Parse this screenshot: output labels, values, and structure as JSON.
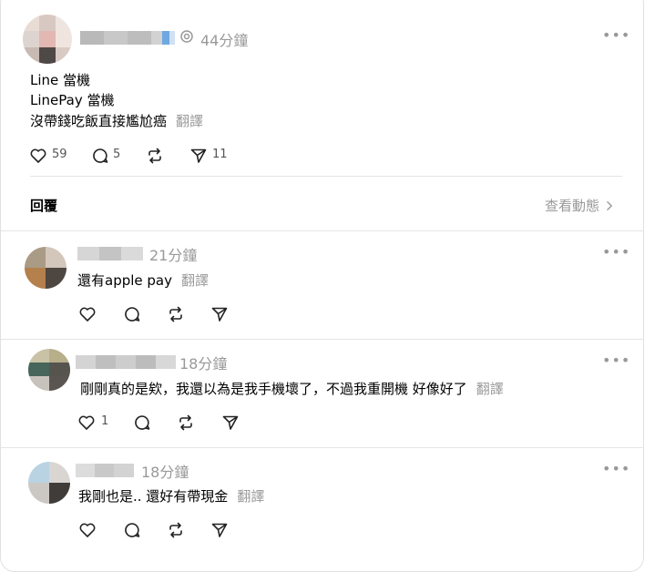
{
  "post": {
    "time": "44分鐘",
    "lines": [
      "Line 當機",
      "LinePay 當機",
      "沒帶錢吃飯直接尷尬癌"
    ],
    "translate": "翻譯",
    "likes": "59",
    "comments": "5",
    "shares": "11"
  },
  "replies_header": {
    "title": "回覆",
    "view_activity": "查看動態"
  },
  "replies": [
    {
      "time": "21分鐘",
      "text": "還有apple pay",
      "translate": "翻譯",
      "likes": ""
    },
    {
      "time": "18分鐘",
      "text": "剛剛真的是欸，我還以為是我手機壞了，不過我重開機 好像好了",
      "translate": "翻譯",
      "likes": "1"
    },
    {
      "time": "18分鐘",
      "text": "我剛也是.. 還好有帶現金",
      "translate": "翻譯",
      "likes": ""
    }
  ],
  "icons": [
    "heart-icon",
    "comment-icon",
    "repost-icon",
    "share-icon",
    "more-icon",
    "chevron-right-icon",
    "pin-icon"
  ],
  "colors": {
    "muted": "#999999",
    "divider": "#e4e4e4",
    "text": "#000000"
  }
}
